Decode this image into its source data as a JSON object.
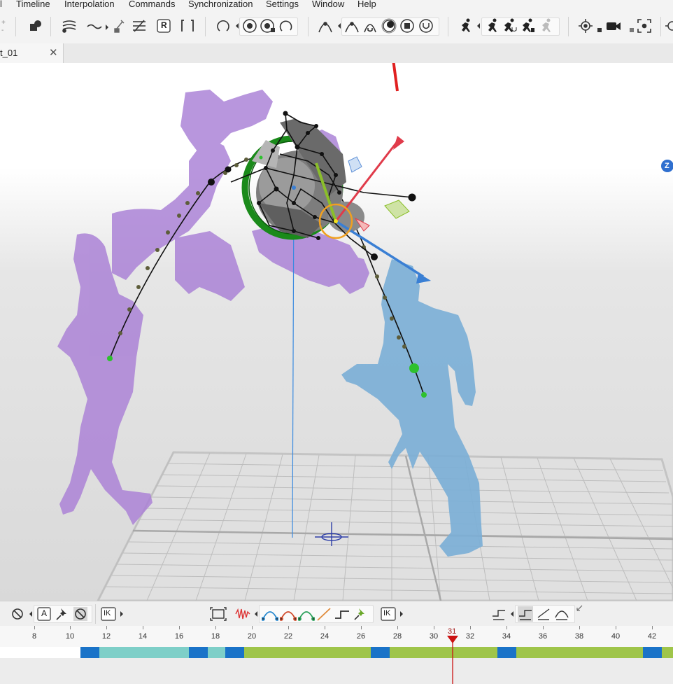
{
  "menu": {
    "items": [
      "l",
      "Timeline",
      "Interpolation",
      "Commands",
      "Synchronization",
      "Settings",
      "Window",
      "Help"
    ]
  },
  "toolbar": {
    "r_button_label": "R"
  },
  "tabs": [
    {
      "label": "t_01"
    }
  ],
  "viewport": {
    "axis_badge": "Z",
    "colors": {
      "ghost_purple": "#a97fd6",
      "ghost_blue": "#7aaed6",
      "rotation_ring": "#1a8a1a",
      "axis_x": "#e03b4a",
      "axis_y": "#3a7fd4",
      "grid_line": "#b9b9b9"
    }
  },
  "animbar": {
    "a_label": "A",
    "ik_label": "IK",
    "ik2_label": "IK"
  },
  "timeline": {
    "ticks": [
      "8",
      "10",
      "12",
      "14",
      "16",
      "18",
      "20",
      "22",
      "24",
      "26",
      "28",
      "30",
      "32",
      "34",
      "36",
      "38",
      "40",
      "42"
    ],
    "current_frame": "31",
    "colors": {
      "key": "#1a73c8",
      "interp_teal": "#7ecfc8",
      "interp_green": "#9fc54a",
      "playhead": "#cc1111"
    }
  }
}
